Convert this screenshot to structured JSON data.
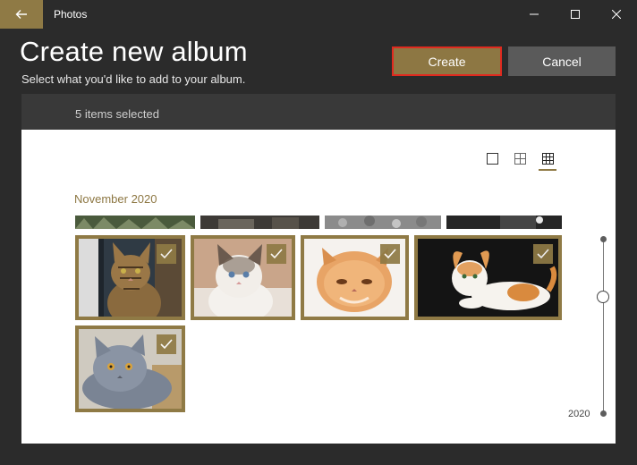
{
  "window": {
    "app_title": "Photos"
  },
  "header": {
    "title": "Create new album",
    "subtitle": "Select what you'd like to add to your album."
  },
  "actions": {
    "create_label": "Create",
    "cancel_label": "Cancel"
  },
  "selection": {
    "count_text": "5 items selected"
  },
  "view_modes": [
    "single-view-icon",
    "medium-grid-icon",
    "small-grid-icon"
  ],
  "gallery": {
    "month": "November 2020",
    "photos": [
      {
        "name": "tabby-cat-photo",
        "selected": true
      },
      {
        "name": "ragdoll-kitten-photo",
        "selected": true
      },
      {
        "name": "persian-kitten-photo",
        "selected": true
      },
      {
        "name": "curl-cat-photo",
        "selected": true
      },
      {
        "name": "british-shorthair-photo",
        "selected": true
      }
    ]
  },
  "timeline": {
    "year": "2020"
  },
  "colors": {
    "accent": "#8f7a45",
    "focus_outline": "#e02a1f",
    "dark_bg": "#2b2b2b"
  }
}
